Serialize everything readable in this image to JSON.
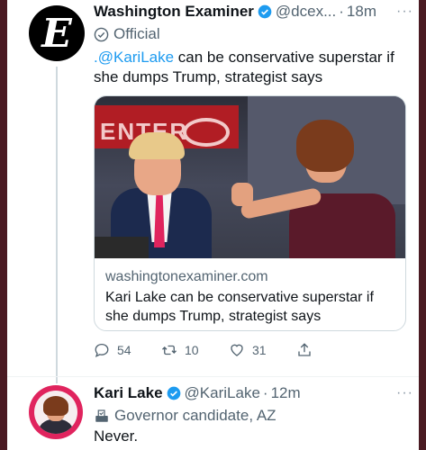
{
  "tweet1": {
    "author_name": "Washington Examiner",
    "handle": "@dcex...",
    "separator": "·",
    "time": "18m",
    "more": "···",
    "avatar_glyph": "E",
    "label": "Official",
    "mention": ".@KariLake",
    "text_rest": " can be conservative superstar if she dumps Trump, strategist says",
    "card": {
      "domain": "washingtonexaminer.com",
      "title": "Kari Lake can be conservative superstar if she dumps Trump, strategist says",
      "banner_text": "ENTER"
    },
    "actions": {
      "replies": "54",
      "retweets": "10",
      "likes": "31"
    }
  },
  "tweet2": {
    "author_name": "Kari Lake",
    "handle": "@KariLake",
    "separator": "·",
    "time": "12m",
    "more": "···",
    "label": "Governor candidate, AZ",
    "text": "Never."
  },
  "colors": {
    "accent": "#1d9bf0",
    "muted": "#536471",
    "background": "#ffffff",
    "outer_frame": "#4a1a22"
  },
  "icons": [
    "verified-badge-icon",
    "official-badge-icon",
    "reply-icon",
    "retweet-icon",
    "like-icon",
    "share-icon",
    "ballot-box-icon",
    "more-icon"
  ]
}
